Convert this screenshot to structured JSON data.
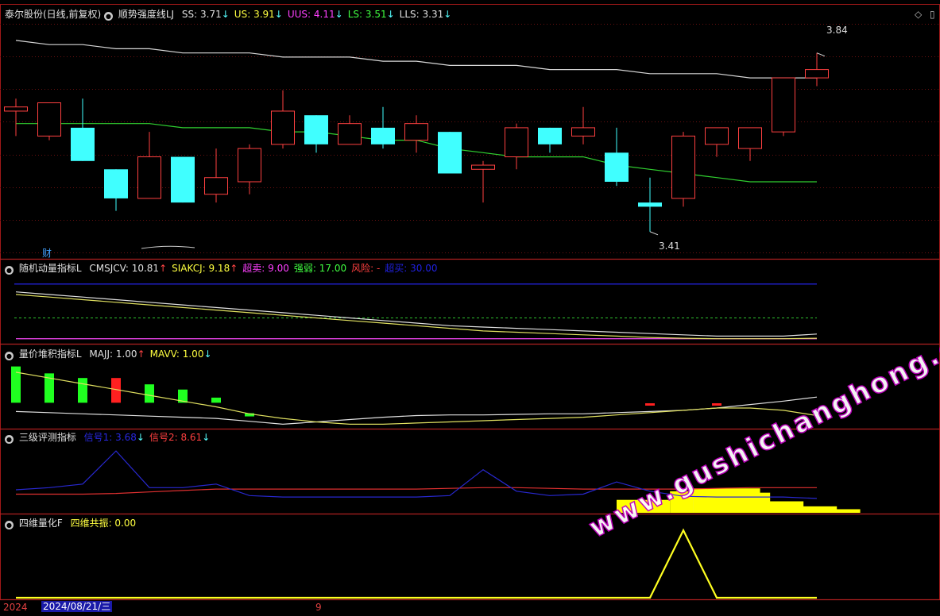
{
  "header": {
    "stock": "泰尔股份(日线,前复权)",
    "indicator": "顺势强度线LJ",
    "items": [
      {
        "k": "SS:",
        "v": "3.71",
        "dir": "down",
        "color": "#e0e0e0"
      },
      {
        "k": "US:",
        "v": "3.91",
        "dir": "down",
        "color": "#ffff40"
      },
      {
        "k": "UUS:",
        "v": "4.11",
        "dir": "down",
        "color": "#ff40ff"
      },
      {
        "k": "LS:",
        "v": "3.51",
        "dir": "down",
        "color": "#40ff40"
      },
      {
        "k": "LLS:",
        "v": "3.31",
        "dir": "down",
        "color": "#e0e0e0"
      }
    ],
    "right_icons": [
      "diamond-icon",
      "window-icon"
    ]
  },
  "price_high_label": "3.84",
  "price_low_label": "3.41",
  "cai_label": "财",
  "panel2": {
    "title": "随机动量指标L",
    "items": [
      {
        "k": "CMSJCV:",
        "v": "10.81",
        "dir": "up",
        "color": "#e0e0e0"
      },
      {
        "k": "SIAKCJ:",
        "v": "9.18",
        "dir": "up",
        "color": "#ffff40"
      },
      {
        "k": "超卖:",
        "v": "9.00",
        "dir": "",
        "color": "#ff40ff"
      },
      {
        "k": "强弱:",
        "v": "17.00",
        "dir": "",
        "color": "#40ff40"
      },
      {
        "k": "风险:",
        "v": "-",
        "dir": "",
        "color": "#ff4040"
      },
      {
        "k": "超买:",
        "v": "30.00",
        "dir": "",
        "color": "#2020e0"
      }
    ]
  },
  "panel3": {
    "title": "量价堆积指标L",
    "items": [
      {
        "k": "MAJJ:",
        "v": "1.00",
        "dir": "up",
        "color": "#e0e0e0"
      },
      {
        "k": "MAVV:",
        "v": "1.00",
        "dir": "down",
        "color": "#ffff40"
      }
    ]
  },
  "panel4": {
    "title": "三级评测指标",
    "items": [
      {
        "k": "信号1:",
        "v": "3.68",
        "dir": "down",
        "color": "#2828e0"
      },
      {
        "k": "信号2:",
        "v": "8.61",
        "dir": "down",
        "color": "#ff4040"
      }
    ]
  },
  "panel5": {
    "title": "四维量化F",
    "items": [
      {
        "k": "四维共振:",
        "v": "0.00",
        "dir": "",
        "color": "#ffff40"
      }
    ]
  },
  "footer": {
    "year": "2024",
    "date": "2024/08/21/三",
    "mark": "9"
  },
  "watermark": "www.gushichanghong.com",
  "chart_data": {
    "type": "candlestick",
    "candles": [
      {
        "o": 3.7,
        "h": 3.73,
        "l": 3.64,
        "c": 3.71
      },
      {
        "o": 3.64,
        "h": 3.71,
        "l": 3.63,
        "c": 3.72
      },
      {
        "o": 3.66,
        "h": 3.73,
        "l": 3.58,
        "c": 3.58
      },
      {
        "o": 3.56,
        "h": 3.56,
        "l": 3.46,
        "c": 3.49
      },
      {
        "o": 3.49,
        "h": 3.65,
        "l": 3.49,
        "c": 3.59
      },
      {
        "o": 3.59,
        "h": 3.59,
        "l": 3.48,
        "c": 3.48
      },
      {
        "o": 3.5,
        "h": 3.61,
        "l": 3.48,
        "c": 3.54
      },
      {
        "o": 3.53,
        "h": 3.62,
        "l": 3.5,
        "c": 3.61
      },
      {
        "o": 3.62,
        "h": 3.75,
        "l": 3.61,
        "c": 3.7
      },
      {
        "o": 3.69,
        "h": 3.69,
        "l": 3.6,
        "c": 3.62
      },
      {
        "o": 3.62,
        "h": 3.69,
        "l": 3.62,
        "c": 3.67
      },
      {
        "o": 3.66,
        "h": 3.71,
        "l": 3.61,
        "c": 3.62
      },
      {
        "o": 3.63,
        "h": 3.69,
        "l": 3.6,
        "c": 3.67
      },
      {
        "o": 3.65,
        "h": 3.65,
        "l": 3.55,
        "c": 3.55
      },
      {
        "o": 3.56,
        "h": 3.58,
        "l": 3.48,
        "c": 3.57
      },
      {
        "o": 3.59,
        "h": 3.67,
        "l": 3.56,
        "c": 3.66
      },
      {
        "o": 3.66,
        "h": 3.66,
        "l": 3.6,
        "c": 3.62
      },
      {
        "o": 3.64,
        "h": 3.71,
        "l": 3.62,
        "c": 3.66
      },
      {
        "o": 3.6,
        "h": 3.66,
        "l": 3.52,
        "c": 3.53
      },
      {
        "o": 3.48,
        "h": 3.54,
        "l": 3.41,
        "c": 3.47
      },
      {
        "o": 3.49,
        "h": 3.65,
        "l": 3.47,
        "c": 3.64
      },
      {
        "o": 3.62,
        "h": 3.62,
        "l": 3.59,
        "c": 3.66
      },
      {
        "o": 3.61,
        "h": 3.66,
        "l": 3.58,
        "c": 3.66
      },
      {
        "o": 3.65,
        "h": 3.77,
        "l": 3.64,
        "c": 3.78
      },
      {
        "o": 3.78,
        "h": 3.84,
        "l": 3.76,
        "c": 3.8
      }
    ],
    "ma_white": [
      3.87,
      3.86,
      3.86,
      3.85,
      3.85,
      3.84,
      3.84,
      3.84,
      3.83,
      3.83,
      3.83,
      3.82,
      3.82,
      3.81,
      3.81,
      3.81,
      3.8,
      3.8,
      3.8,
      3.79,
      3.79,
      3.79,
      3.78,
      3.78,
      3.78
    ],
    "ma_green": [
      3.67,
      3.67,
      3.67,
      3.67,
      3.67,
      3.66,
      3.66,
      3.66,
      3.65,
      3.65,
      3.64,
      3.63,
      3.63,
      3.61,
      3.6,
      3.59,
      3.59,
      3.59,
      3.57,
      3.56,
      3.55,
      3.54,
      3.53,
      3.53,
      3.53
    ],
    "ylim": [
      3.36,
      3.91
    ],
    "panel2": {
      "white": [
        27,
        26,
        25,
        24,
        23,
        22,
        21,
        20,
        19,
        18,
        17,
        16,
        15,
        14,
        13.5,
        13,
        12.5,
        12,
        11.5,
        11,
        10.5,
        10,
        10,
        10,
        10.8
      ],
      "yellow": [
        26,
        25,
        24,
        23,
        22,
        21,
        20,
        19,
        18,
        17,
        16,
        15,
        14,
        13,
        12,
        11.5,
        11,
        10.5,
        10,
        9.5,
        9.2,
        9,
        9,
        9,
        9.2
      ],
      "purple": [
        9,
        9,
        9,
        9,
        9,
        9,
        9,
        9,
        9,
        9,
        9,
        9,
        9,
        9,
        9,
        9,
        9,
        9,
        9,
        9,
        9,
        9,
        9,
        9,
        9
      ],
      "green": 17,
      "blue": 30,
      "ylim": [
        8,
        33
      ]
    },
    "panel3": {
      "bars": [
        {
          "v": 1.0,
          "c": "green"
        },
        {
          "v": 0.88,
          "c": "green"
        },
        {
          "v": 0.8,
          "c": "green"
        },
        {
          "v": 0.8,
          "c": "red"
        },
        {
          "v": 0.69,
          "c": "green"
        },
        {
          "v": 0.6,
          "c": "green"
        },
        {
          "v": 0.46,
          "c": "green"
        },
        {
          "v": 0.19,
          "c": "green"
        },
        {
          "v": 0,
          "c": "green"
        },
        {
          "v": 0,
          "c": "green"
        },
        {
          "v": 0,
          "c": "green"
        },
        {
          "v": 0,
          "c": "green"
        },
        {
          "v": 0,
          "c": "green"
        },
        {
          "v": 0,
          "c": "green"
        },
        {
          "v": 0,
          "c": "green"
        },
        {
          "v": 0,
          "c": "green"
        },
        {
          "v": 0,
          "c": "green"
        },
        {
          "v": 0,
          "c": "green"
        },
        {
          "v": 0,
          "c": "green"
        },
        {
          "v": 0.02,
          "c": "red"
        },
        {
          "v": 0,
          "c": "green"
        },
        {
          "v": 0.02,
          "c": "red"
        },
        {
          "v": 0,
          "c": "green"
        },
        {
          "v": 0,
          "c": "green"
        },
        {
          "v": 0,
          "c": "green"
        }
      ],
      "white": [
        0.22,
        0.2,
        0.18,
        0.16,
        0.14,
        0.12,
        0.1,
        0.05,
        0.0,
        0.04,
        0.08,
        0.12,
        0.15,
        0.16,
        0.16,
        0.17,
        0.18,
        0.18,
        0.2,
        0.22,
        0.24,
        0.28,
        0.34,
        0.4,
        0.47
      ],
      "yellow": [
        0.9,
        0.8,
        0.7,
        0.6,
        0.5,
        0.4,
        0.3,
        0.18,
        0.1,
        0.04,
        0.0,
        0.0,
        0.02,
        0.04,
        0.06,
        0.08,
        0.1,
        0.12,
        0.16,
        0.2,
        0.24,
        0.28,
        0.28,
        0.24,
        0.15
      ],
      "ylim": [
        -0.05,
        1.05
      ]
    },
    "panel4": {
      "blue": [
        3.2,
        3.5,
        4.0,
        8.6,
        3.5,
        3.5,
        4.0,
        2.4,
        2.2,
        2.2,
        2.2,
        2.2,
        2.2,
        2.4,
        6.0,
        3.0,
        2.4,
        2.6,
        4.3,
        3.0,
        2.3,
        2.2,
        2.2,
        2.2,
        2.0
      ],
      "red": [
        2.6,
        2.6,
        2.6,
        2.7,
        2.9,
        3.1,
        3.3,
        3.3,
        3.3,
        3.3,
        3.3,
        3.3,
        3.3,
        3.4,
        3.5,
        3.5,
        3.4,
        3.3,
        3.3,
        3.3,
        3.3,
        3.4,
        3.5,
        3.5,
        3.5
      ],
      "blocks": [
        {
          "i0": 18.0,
          "i1": 19.6,
          "v": 1.8,
          "c": "#ffff00"
        },
        {
          "i0": 19.6,
          "i1": 20.3,
          "v": 3.0,
          "c": "#ffff00"
        },
        {
          "i0": 20.3,
          "i1": 21.0,
          "v": 3.2,
          "c": "#ffffff"
        },
        {
          "i0": 20.3,
          "i1": 22.3,
          "v": 3.4,
          "c": "#ffff00"
        },
        {
          "i0": 21.0,
          "i1": 22.6,
          "v": 2.8,
          "c": "#ffff00"
        },
        {
          "i0": 22.0,
          "i1": 23.6,
          "v": 1.6,
          "c": "#ffff00"
        },
        {
          "i0": 23.0,
          "i1": 24.6,
          "v": 0.9,
          "c": "#ffff00"
        },
        {
          "i0": 24.0,
          "i1": 25.3,
          "v": 0.5,
          "c": "#ffff00"
        }
      ],
      "ylim": [
        0,
        9.5
      ]
    },
    "panel5": {
      "values": [
        0,
        0,
        0,
        0,
        0,
        0,
        0,
        0,
        0,
        0,
        0,
        0,
        0,
        0,
        0,
        0,
        0,
        0,
        0,
        0,
        100,
        0,
        0,
        0,
        0
      ],
      "ylim": [
        0,
        100
      ]
    }
  }
}
